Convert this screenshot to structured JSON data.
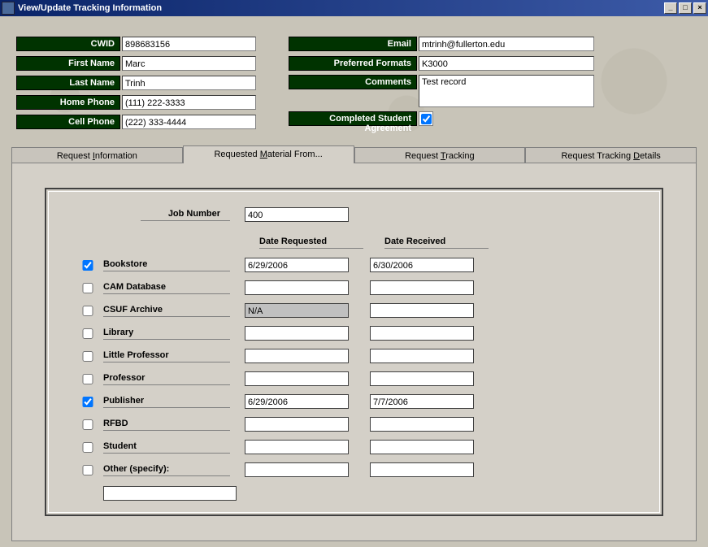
{
  "window": {
    "title": "View/Update Tracking Information"
  },
  "student": {
    "labels": {
      "cwid": "CWID",
      "first_name": "First Name",
      "last_name": "Last Name",
      "home_phone": "Home Phone",
      "cell_phone": "Cell Phone",
      "email": "Email",
      "preferred_formats": "Preferred Formats",
      "comments": "Comments",
      "completed_agreement": "Completed Student Agreement"
    },
    "cwid": "898683156",
    "first_name": "Marc",
    "last_name": "Trinh",
    "home_phone": "(111) 222-3333",
    "cell_phone": "(222) 333-4444",
    "email": "mtrinh@fullerton.edu",
    "preferred_formats": "K3000",
    "comments": "Test record",
    "completed_agreement": true
  },
  "tabs": {
    "request_info": "Request Information",
    "requested_from": "Requested Material From...",
    "request_tracking": "Request Tracking",
    "tracking_details": "Request Tracking Details"
  },
  "form": {
    "job_number_label": "Job Number",
    "job_number": "400",
    "headers": {
      "date_requested": "Date Requested",
      "date_received": "Date Received"
    },
    "sources": [
      {
        "label": "Bookstore",
        "checked": true,
        "requested": "6/29/2006",
        "received": "6/30/2006",
        "req_disabled": false
      },
      {
        "label": "CAM Database",
        "checked": false,
        "requested": "",
        "received": "",
        "req_disabled": false
      },
      {
        "label": "CSUF Archive",
        "checked": false,
        "requested": "N/A",
        "received": "",
        "req_disabled": true
      },
      {
        "label": "Library",
        "checked": false,
        "requested": "",
        "received": "",
        "req_disabled": false
      },
      {
        "label": "Little Professor",
        "checked": false,
        "requested": "",
        "received": "",
        "req_disabled": false
      },
      {
        "label": "Professor",
        "checked": false,
        "requested": "",
        "received": "",
        "req_disabled": false
      },
      {
        "label": "Publisher",
        "checked": true,
        "requested": "6/29/2006",
        "received": "7/7/2006",
        "req_disabled": false
      },
      {
        "label": "RFBD",
        "checked": false,
        "requested": "",
        "received": "",
        "req_disabled": false
      },
      {
        "label": "Student",
        "checked": false,
        "requested": "",
        "received": "",
        "req_disabled": false
      },
      {
        "label": "Other (specify):",
        "checked": false,
        "requested": "",
        "received": "",
        "req_disabled": false
      }
    ],
    "other_value": ""
  }
}
